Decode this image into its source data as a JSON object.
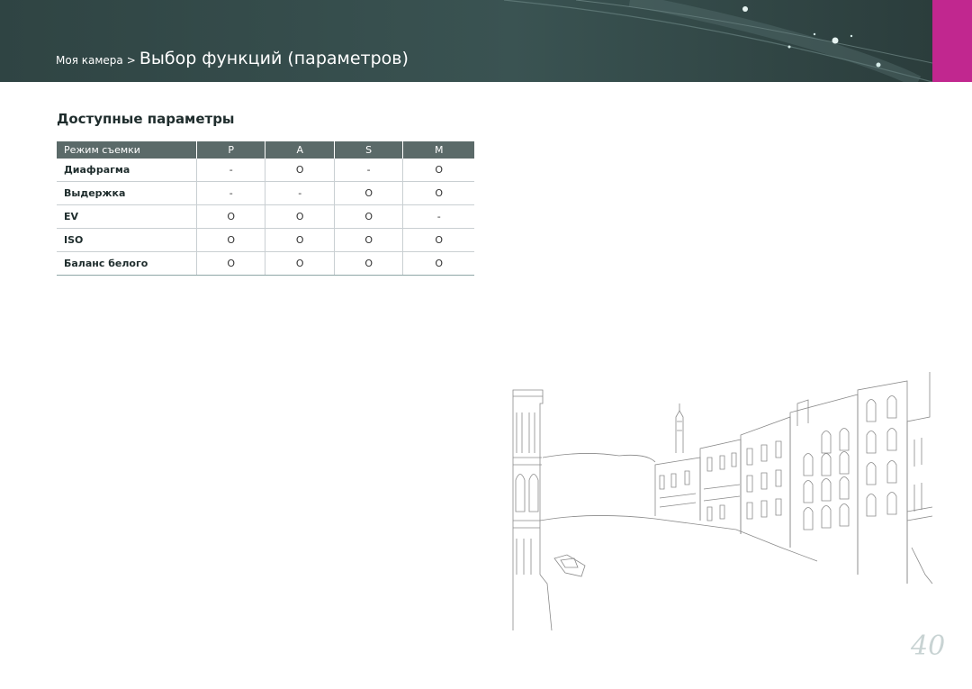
{
  "header": {
    "breadcrumb_parent": "Моя камера",
    "breadcrumb_separator": ">",
    "breadcrumb_current": "Выбор функций (параметров)",
    "accent_color": "#c1278f",
    "banner_color": "#2f4443"
  },
  "section": {
    "title": "Доступные параметры"
  },
  "table": {
    "columns": [
      "Режим съемки",
      "P",
      "A",
      "S",
      "M"
    ],
    "rows": [
      {
        "label": "Диафрагма",
        "cells": [
          "-",
          "O",
          "-",
          "O"
        ]
      },
      {
        "label": "Выдержка",
        "cells": [
          "-",
          "-",
          "O",
          "O"
        ]
      },
      {
        "label": "EV",
        "cells": [
          "O",
          "O",
          "O",
          "-"
        ]
      },
      {
        "label": "ISO",
        "cells": [
          "O",
          "O",
          "O",
          "O"
        ]
      },
      {
        "label": "Баланс белого",
        "cells": [
          "O",
          "O",
          "O",
          "O"
        ]
      }
    ]
  },
  "page": {
    "number": "40"
  }
}
